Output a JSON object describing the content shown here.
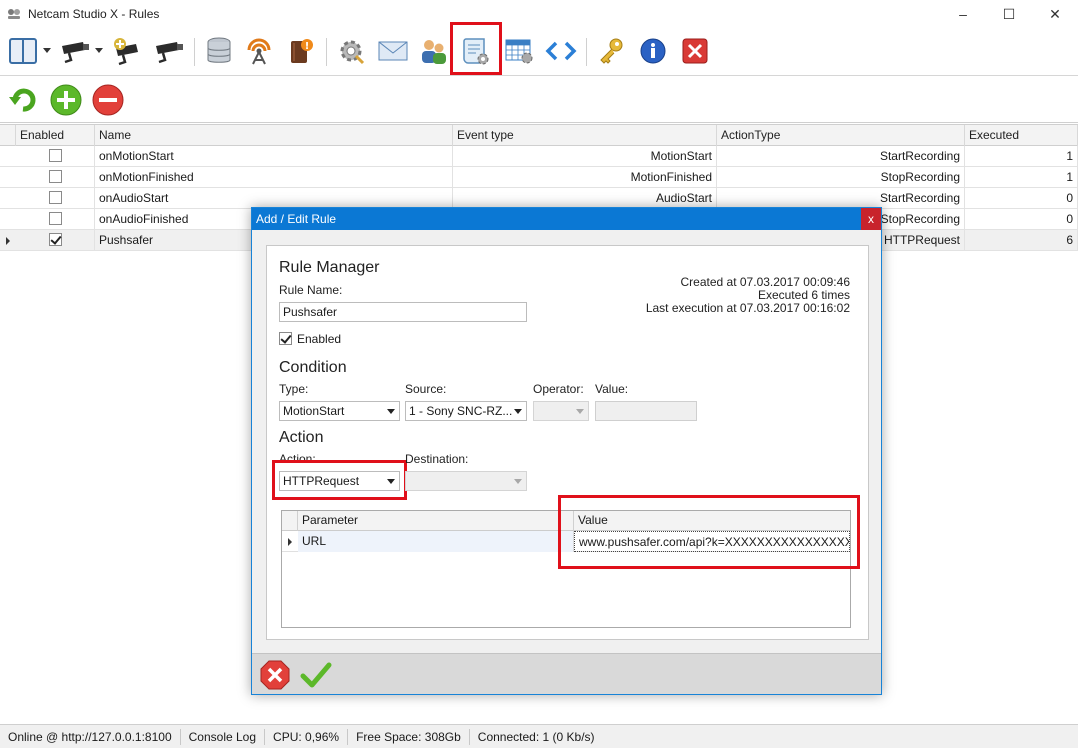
{
  "window": {
    "title": "Netcam Studio X - Rules",
    "controls": {
      "minimize": "–",
      "maximize": "☐",
      "close": "✕"
    }
  },
  "toolbar": {
    "buttons": [
      {
        "name": "layout-button",
        "icon": "layout-panel-icon"
      },
      {
        "name": "cameras-button",
        "icon": "camera-icon"
      },
      {
        "name": "add-camera-button",
        "icon": "camera-add-icon"
      },
      {
        "name": "camera-settings-button",
        "icon": "camera-icon"
      },
      {
        "name": "storage-button",
        "icon": "database-icon"
      },
      {
        "name": "streaming-button",
        "icon": "broadcast-icon"
      },
      {
        "name": "alerts-button",
        "icon": "book-alert-icon"
      },
      {
        "name": "settings-button",
        "icon": "gear-icon"
      },
      {
        "name": "email-button",
        "icon": "envelope-icon"
      },
      {
        "name": "users-button",
        "icon": "users-icon"
      },
      {
        "name": "rules-button",
        "icon": "scroll-gear-icon"
      },
      {
        "name": "schedule-button",
        "icon": "table-gear-icon"
      },
      {
        "name": "scripts-button",
        "icon": "code-icon"
      },
      {
        "name": "license-button",
        "icon": "key-icon"
      },
      {
        "name": "about-button",
        "icon": "info-icon"
      },
      {
        "name": "exit-button",
        "icon": "close-red-icon"
      }
    ]
  },
  "subtoolbar": {
    "refresh": "refresh-icon",
    "add": "add-icon",
    "remove": "remove-icon"
  },
  "grid": {
    "columns": [
      "Enabled",
      "Name",
      "Event type",
      "ActionType",
      "Executed"
    ],
    "rows": [
      {
        "enabled": false,
        "name": "onMotionStart",
        "event": "MotionStart",
        "action": "StartRecording",
        "executed": "1"
      },
      {
        "enabled": false,
        "name": "onMotionFinished",
        "event": "MotionFinished",
        "action": "StopRecording",
        "executed": "1"
      },
      {
        "enabled": false,
        "name": "onAudioStart",
        "event": "AudioStart",
        "action": "StartRecording",
        "executed": "0"
      },
      {
        "enabled": false,
        "name": "onAudioFinished",
        "event": "",
        "action": "StopRecording",
        "executed": "0"
      },
      {
        "enabled": true,
        "name": "Pushsafer",
        "event": "",
        "action": "HTTPRequest",
        "executed": "6"
      }
    ]
  },
  "dialog": {
    "title": "Add / Edit Rule",
    "close": "x",
    "rule_manager": {
      "heading": "Rule Manager",
      "name_label": "Rule Name:",
      "name_value": "Pushsafer",
      "enabled_label": "Enabled",
      "created": "Created at 07.03.2017 00:09:46",
      "executed": "Executed 6 times",
      "last_execution": "Last execution at 07.03.2017 00:16:02"
    },
    "condition": {
      "heading": "Condition",
      "type_label": "Type:",
      "type_value": "MotionStart",
      "source_label": "Source:",
      "source_value": "1 - Sony SNC-RZ...",
      "operator_label": "Operator:",
      "operator_value": "",
      "value_label": "Value:",
      "value_value": ""
    },
    "action": {
      "heading": "Action",
      "action_label": "Action:",
      "action_value": "HTTPRequest",
      "destination_label": "Destination:",
      "destination_value": ""
    },
    "parameters": {
      "columns": [
        "Parameter",
        "Value"
      ],
      "rows": [
        {
          "parameter": "URL",
          "value": "www.pushsafer.com/api?k=XXXXXXXXXXXXXXXXXXX&d="
        }
      ]
    },
    "footer": {
      "cancel": "cancel-icon",
      "ok": "checkmark-icon"
    }
  },
  "statusbar": {
    "online": "Online @ http://127.0.0.1:8100",
    "console": "Console Log",
    "cpu": "CPU: 0,96%",
    "free_space": "Free Space: 308Gb",
    "connected": "Connected: 1 (0 Kb/s)"
  },
  "colors": {
    "highlight": "#e0101a",
    "dialog_title": "#0b78d4",
    "dialog_close": "#c8232c"
  }
}
